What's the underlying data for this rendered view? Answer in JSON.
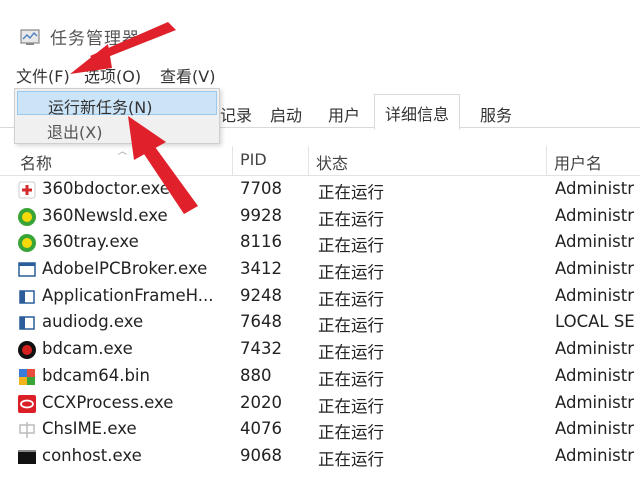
{
  "window": {
    "title": "任务管理器"
  },
  "menubar": {
    "file": "文件(F)",
    "options": "选项(O)",
    "view": "查看(V)"
  },
  "file_menu": {
    "run_new_task": "运行新任务(N)",
    "exit": "退出(X)"
  },
  "tabs": {
    "app_history": "记录",
    "startup": "启动",
    "users": "用户",
    "details": "详细信息",
    "services": "服务"
  },
  "columns": {
    "name": "名称",
    "pid": "PID",
    "status": "状态",
    "user": "用户名"
  },
  "processes": [
    {
      "name": "360bdoctor.exe",
      "pid": "7708",
      "status": "正在运行",
      "user": "Administr",
      "icon": "360-doctor-icon"
    },
    {
      "name": "360Newsld.exe",
      "pid": "9928",
      "status": "正在运行",
      "user": "Administr",
      "icon": "360-news-icon"
    },
    {
      "name": "360tray.exe",
      "pid": "8116",
      "status": "正在运行",
      "user": "Administr",
      "icon": "360-tray-icon"
    },
    {
      "name": "AdobeIPCBroker.exe",
      "pid": "3412",
      "status": "正在运行",
      "user": "Administr",
      "icon": "adobe-ipc-icon"
    },
    {
      "name": "ApplicationFrameH...",
      "pid": "9248",
      "status": "正在运行",
      "user": "Administr",
      "icon": "app-frame-icon"
    },
    {
      "name": "audiodg.exe",
      "pid": "7648",
      "status": "正在运行",
      "user": "LOCAL SE",
      "icon": "audiodg-icon"
    },
    {
      "name": "bdcam.exe",
      "pid": "7432",
      "status": "正在运行",
      "user": "Administr",
      "icon": "bdcam-icon"
    },
    {
      "name": "bdcam64.bin",
      "pid": "880",
      "status": "正在运行",
      "user": "Administr",
      "icon": "bdcam64-icon"
    },
    {
      "name": "CCXProcess.exe",
      "pid": "2020",
      "status": "正在运行",
      "user": "Administr",
      "icon": "ccx-process-icon"
    },
    {
      "name": "ChsIME.exe",
      "pid": "4076",
      "status": "正在运行",
      "user": "Administr",
      "icon": "chs-ime-icon"
    },
    {
      "name": "conhost.exe",
      "pid": "9068",
      "status": "正在运行",
      "user": "Administr",
      "icon": "conhost-icon"
    }
  ],
  "colors": {
    "menu_highlight": "#cce4f7",
    "annotation_arrow": "#e0202a"
  }
}
